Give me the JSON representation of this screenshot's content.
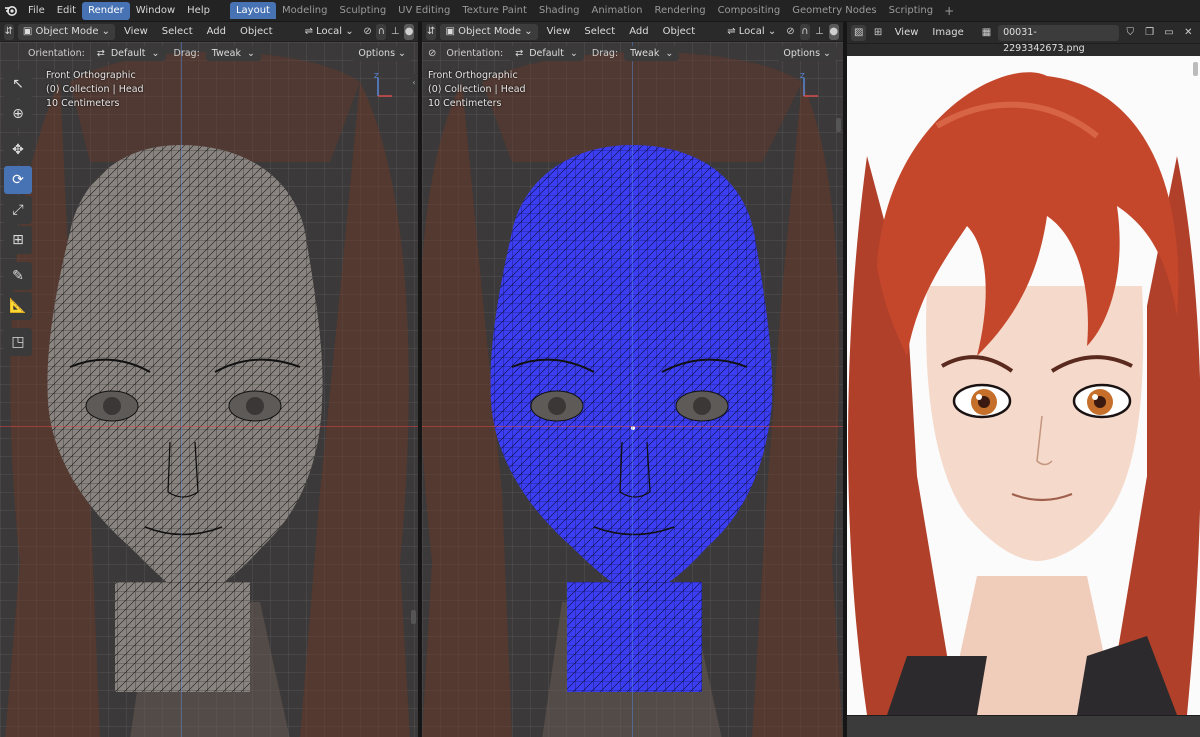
{
  "topbar": {
    "menu": [
      "File",
      "Edit",
      "Render",
      "Window",
      "Help"
    ],
    "active_menu_index": 2,
    "workspaces": [
      "Layout",
      "Modeling",
      "Sculpting",
      "UV Editing",
      "Texture Paint",
      "Shading",
      "Animation",
      "Rendering",
      "Compositing",
      "Geometry Nodes",
      "Scripting"
    ],
    "active_workspace_index": 0,
    "add_workspace": "+"
  },
  "viewport_left": {
    "mode": "Object Mode",
    "menu": [
      "View",
      "Select",
      "Add",
      "Object"
    ],
    "transform": "Local",
    "orientation_label": "Orientation:",
    "orientation_value": "Default",
    "drag_label": "Drag:",
    "drag_value": "Tweak",
    "options": "Options",
    "overlay": {
      "view": "Front Orthographic",
      "collection": "(0) Collection | Head",
      "scale": "10 Centimeters"
    },
    "mesh_color": "#8a8480",
    "mesh_line": "#1a1a1a"
  },
  "viewport_right": {
    "mode": "Object Mode",
    "menu": [
      "View",
      "Select",
      "Add",
      "Object"
    ],
    "transform": "Local",
    "orientation_label": "Orientation:",
    "orientation_value": "Default",
    "drag_label": "Drag:",
    "drag_value": "Tweak",
    "options": "Options",
    "overlay": {
      "view": "Front Orthographic",
      "collection": "(0) Collection | Head",
      "scale": "10 Centimeters"
    },
    "mesh_color": "#3b3ef2",
    "mesh_line": "#0d0d3a"
  },
  "image_editor": {
    "menu": [
      "View",
      "Image"
    ],
    "filename": "00031-2293342673.png"
  },
  "tools": [
    "select-box",
    "cursor",
    "move",
    "rotate",
    "scale",
    "transform",
    "annotate",
    "measure",
    "add-cube"
  ],
  "active_tool_index": 3,
  "colors": {
    "accent": "#4772b3",
    "hair": "#b8442a",
    "skin": "#f3d7c6",
    "iris": "#c56f2a"
  }
}
